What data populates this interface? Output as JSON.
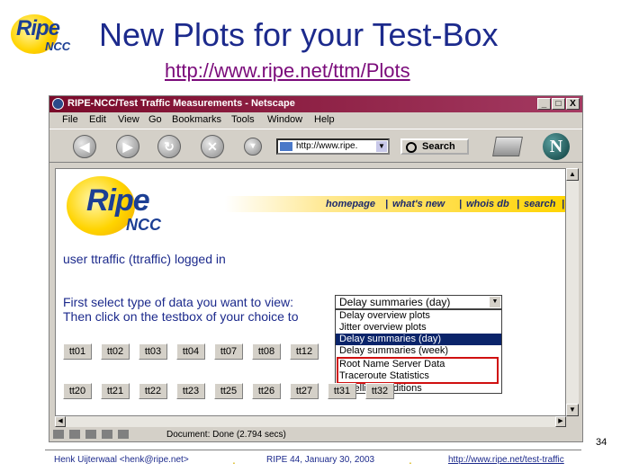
{
  "slide": {
    "logo_ripe": "Ripe",
    "logo_ncc": "NCC",
    "title": "New Plots for your Test-Box",
    "url": "http://www.ripe.net/ttm/Plots",
    "page_number": "34",
    "footer_left": "Henk Uijterwaal <henk@ripe.net>",
    "footer_mid": "RIPE 44, January 30, 2003",
    "footer_right": "http://www.ripe.net/test-traffic",
    "footer_dot": "."
  },
  "browser": {
    "window_title": "RIPE-NCC/Test Traffic Measurements - Netscape",
    "window_buttons": [
      "_",
      "□",
      "X"
    ],
    "menu": [
      "File",
      "Edit",
      "View",
      "Go",
      "Bookmarks",
      "Tools",
      "Window",
      "Help"
    ],
    "nav_icons": [
      "back-icon",
      "forward-icon",
      "reload-icon",
      "stop-icon"
    ],
    "url_value": "http://www.ripe.",
    "search_label": "Search",
    "brand_glyph": "N",
    "status_text": "Document: Done (2.794 secs)"
  },
  "page": {
    "logo_ripe": "Ripe",
    "logo_ncc": "NCC",
    "nav_links": [
      "homepage",
      "what's new",
      "whois db",
      "search"
    ],
    "nav_sep": "|",
    "user_status": "user ttraffic (ttraffic) logged in",
    "instruction_1": "First select type of data you want to view:",
    "instruction_2": "Then click on the testbox of your choice to",
    "select_value": "Delay summaries (day)",
    "options": [
      "Delay overview plots",
      "Jitter overview plots",
      "Delay summaries (day)",
      "Delay summaries (week)",
      "Root Name Server Data",
      "Traceroute Statistics",
      "Satellite conditions"
    ],
    "selected_index": 2,
    "testbox_row1": [
      "tt01",
      "tt02",
      "tt03",
      "tt04",
      "tt07",
      "tt08",
      "tt12"
    ],
    "testbox_row2": [
      "tt20",
      "tt21",
      "tt22",
      "tt23",
      "tt25",
      "tt26",
      "tt27",
      "tt31",
      "tt32"
    ],
    "highlight_color": "#d01010",
    "selection_color": "#0a246a"
  }
}
